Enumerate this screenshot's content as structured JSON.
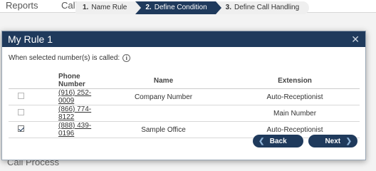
{
  "background": {
    "nav": [
      "Reports",
      "Call"
    ],
    "bottom_text": "Call Process"
  },
  "wizard": {
    "steps": [
      {
        "num": "1.",
        "label": "Name Rule",
        "active": false
      },
      {
        "num": "2.",
        "label": "Define Condition",
        "active": true
      },
      {
        "num": "3.",
        "label": "Define Call Handling",
        "active": false
      }
    ]
  },
  "modal": {
    "title": "My Rule 1",
    "close_icon": "close-icon",
    "prompt": "When selected number(s) is called:",
    "info_icon": "info-icon",
    "table": {
      "headers": [
        "",
        "Phone Number",
        "Name",
        "Extension"
      ],
      "rows": [
        {
          "checked": false,
          "phone": "(916) 252-0009",
          "name": "Company Number",
          "extension": "Auto-Receptionist"
        },
        {
          "checked": false,
          "phone": "(866) 774-8122",
          "name": "",
          "extension": "Main Number"
        },
        {
          "checked": true,
          "phone": "(888) 439-0196",
          "name": "Sample Office",
          "extension": "Auto-Receptionist"
        }
      ]
    },
    "buttons": {
      "back": "Back",
      "next": "Next"
    }
  },
  "colors": {
    "primary": "#1f3a5c",
    "accent": "#8fb4d8"
  }
}
